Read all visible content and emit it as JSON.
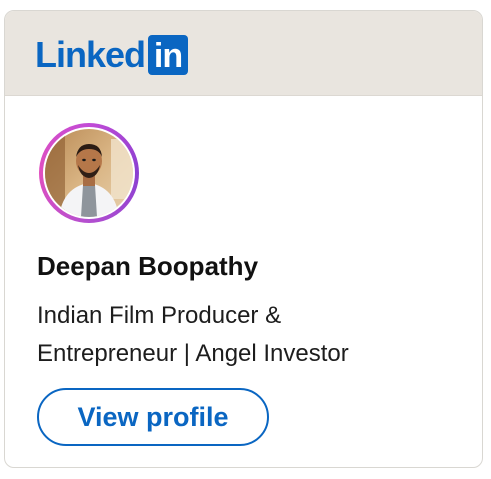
{
  "brand": {
    "word": "Linked",
    "box": "in",
    "color": "#0a66c2"
  },
  "profile": {
    "name": "Deepan Boopathy",
    "headline_line1": "Indian Film Producer &",
    "headline_line2": "Entrepreneur | Angel Investor",
    "avatar_alt": "Deepan Boopathy"
  },
  "actions": {
    "view_profile_label": "View profile"
  }
}
